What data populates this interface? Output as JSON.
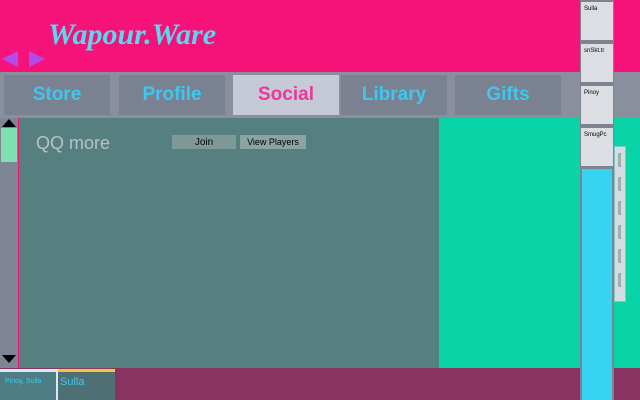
{
  "app": {
    "title": "Wapour.Ware"
  },
  "nav": {
    "tabs": [
      {
        "label": "Store",
        "active": false
      },
      {
        "label": "Profile",
        "active": false
      },
      {
        "label": "Social",
        "active": true
      },
      {
        "label": "Library",
        "active": false
      },
      {
        "label": "Gifts",
        "active": false
      }
    ]
  },
  "social": {
    "group_name": "QQ more",
    "join_label": "Join",
    "view_players_label": "View Players"
  },
  "friends": {
    "items": [
      {
        "name": "Sulla"
      },
      {
        "name": "snSkt.tr"
      },
      {
        "name": "Pinoy"
      },
      {
        "name": "SmugPc"
      }
    ]
  },
  "bottom_tabs": [
    {
      "label": "Pinoy, Sulla"
    },
    {
      "label": "Sulla"
    }
  ],
  "colors": {
    "background": "#f5137a",
    "accent": "#3ec8ef",
    "active_tab_text": "#e83a9a",
    "content": "#56807f",
    "teal": "#08d4a8"
  }
}
